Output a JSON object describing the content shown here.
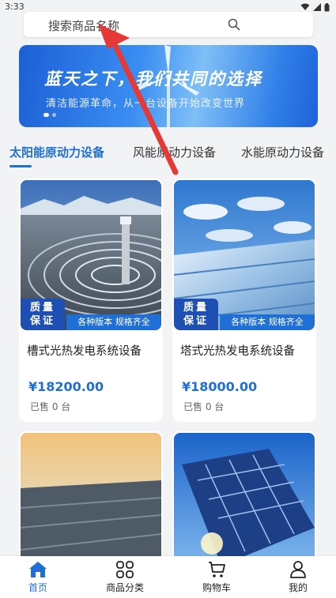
{
  "status_bar": {
    "time": "3:33",
    "icons": [
      "wifi-icon",
      "signal-icon",
      "battery-icon"
    ]
  },
  "search": {
    "placeholder": "搜索商品名称"
  },
  "banner": {
    "title": "蓝天之下，我们共同的选择",
    "subtitle": "清洁能源革命，从一台设备开始改变世界",
    "active_dot": 0,
    "dot_count": 2
  },
  "tabs": [
    {
      "label": "太阳能原动力设备",
      "active": true
    },
    {
      "label": "风能原动力设备",
      "active": false
    },
    {
      "label": "水能原动力设备",
      "active": false
    }
  ],
  "products": [
    {
      "title": "槽式光热发电系统设备",
      "price": "¥18200.00",
      "sold": "已售 0 台",
      "badge_line1": "质量",
      "badge_line2": "保证",
      "versions": "各种版本  规格齐全"
    },
    {
      "title": "塔式光热发电系统设备",
      "price": "¥18000.00",
      "sold": "已售 0 台",
      "badge_line1": "质量",
      "badge_line2": "保证",
      "versions": "各种版本  规格齐全"
    },
    {
      "title": "",
      "price": "",
      "sold": ""
    },
    {
      "title": "",
      "price": "",
      "sold": ""
    }
  ],
  "bottom_nav": [
    {
      "label": "首页",
      "icon": "home-icon",
      "active": true
    },
    {
      "label": "商品分类",
      "icon": "grid-icon",
      "active": false
    },
    {
      "label": "购物车",
      "icon": "cart-icon",
      "active": false
    },
    {
      "label": "我的",
      "icon": "user-icon",
      "active": false
    }
  ],
  "colors": {
    "accent": "#1f6fd6",
    "badge_dark": "#1e4fb3",
    "background": "#f2f3f5",
    "annotation_arrow": "#e53935"
  }
}
